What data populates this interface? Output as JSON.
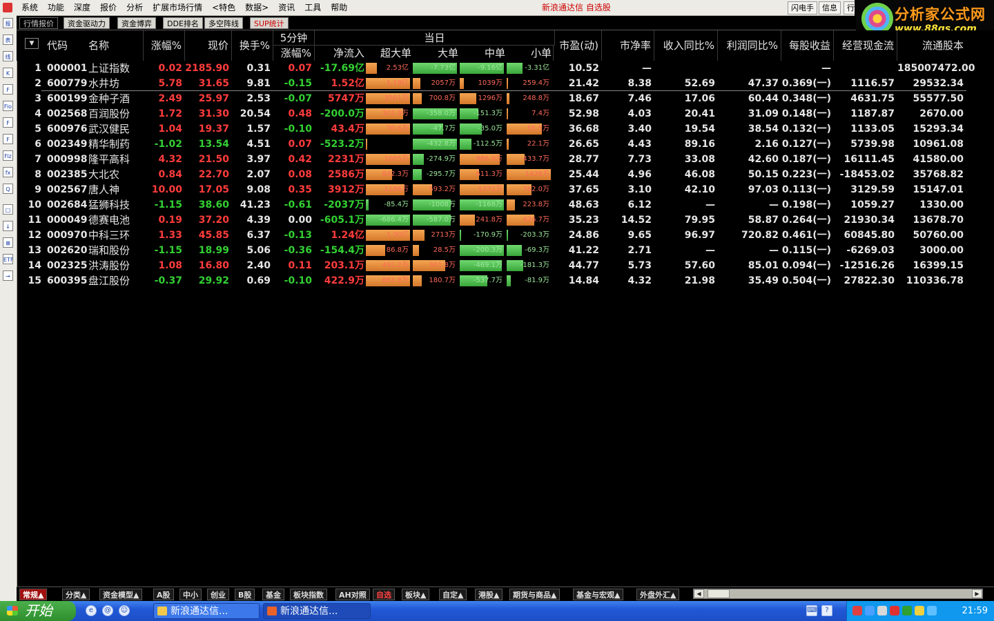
{
  "menu": [
    "系统",
    "功能",
    "深度",
    "报价",
    "分析",
    "扩展市场行情",
    "<特色",
    "数据>",
    "资讯",
    "工具",
    "帮助"
  ],
  "app_title": "新浪通达信  自选股",
  "top_buttons": [
    "闪电手",
    "信息",
    "行"
  ],
  "logo": {
    "title": "分析家公式网",
    "url": "www.88gs.com"
  },
  "left_tools": [
    "报",
    "表",
    "线",
    "K",
    "F",
    "Fio",
    "F",
    "F",
    "Fiz",
    "fx",
    "Q",
    "□",
    "↓",
    "⊠",
    "ETF",
    "→"
  ],
  "tabs": [
    "行情报价",
    "资金驱动力",
    "资金博弈",
    "DDE排名",
    "多空阵线",
    "SUP统计"
  ],
  "header": {
    "code": "代码",
    "name": "名称",
    "change": "涨幅%",
    "price": "现价",
    "turnover": "换手%",
    "five_min": "5分钟",
    "five_min_sub": "涨幅%",
    "today": "当日",
    "net_inflow": "净流入",
    "super_large": "超大单",
    "large": "大单",
    "medium": "中单",
    "small": "小单",
    "pe": "市盈(动)",
    "pb": "市净率",
    "rev_yoy": "收入同比%",
    "profit_yoy": "利润同比%",
    "eps": "每股收益",
    "ocf": "经营现金流",
    "float_shares": "流通股本"
  },
  "rows": [
    {
      "no": "1",
      "code": "000001",
      "name": "上证指数",
      "chg": "0.02",
      "price": "2185.90",
      "turn": "0.31",
      "m5": "0.07",
      "net": "-17.69亿",
      "f": [
        {
          "v": "2.53亿",
          "w": 0.25,
          "s": 1
        },
        {
          "v": "-7.73亿",
          "w": 1.0,
          "s": -1
        },
        {
          "v": "-9.16亿",
          "w": 1.0,
          "s": -1
        },
        {
          "v": "-3.31亿",
          "w": 0.36,
          "s": -1
        }
      ],
      "pe": "10.52",
      "pb": "—",
      "rev": "",
      "prof": "",
      "eps": "—",
      "ocf": "",
      "fs": "185007472.00"
    },
    {
      "no": "2",
      "code": "600779",
      "name": "水井坊",
      "chg": "5.78",
      "price": "31.65",
      "turn": "9.81",
      "m5": "-0.15",
      "net": "1.52亿",
      "f": [
        {
          "v": "1.18亿",
          "w": 1.0,
          "s": 1
        },
        {
          "v": "2057万",
          "w": 0.17,
          "s": 1
        },
        {
          "v": "1039万",
          "w": 0.09,
          "s": 1
        },
        {
          "v": "259.4万",
          "w": 0.03,
          "s": 1
        }
      ],
      "pe": "21.42",
      "pb": "8.38",
      "rev": "52.69",
      "prof": "47.37",
      "eps": "0.369(一)",
      "ocf": "1116.57",
      "fs": "29532.34"
    },
    {
      "no": "3",
      "code": "600199",
      "name": "金种子酒",
      "chg": "2.49",
      "price": "25.97",
      "turn": "2.53",
      "m5": "-0.07",
      "net": "5747万",
      "f": [
        {
          "v": "3501万",
          "w": 1.0,
          "s": 1
        },
        {
          "v": "700.8万",
          "w": 0.2,
          "s": 1
        },
        {
          "v": "1296万",
          "w": 0.37,
          "s": 1
        },
        {
          "v": "248.8万",
          "w": 0.07,
          "s": 1
        }
      ],
      "pe": "18.67",
      "pb": "7.46",
      "rev": "17.06",
      "prof": "60.44",
      "eps": "0.348(一)",
      "ocf": "4631.75",
      "fs": "55577.50"
    },
    {
      "no": "4",
      "code": "002568",
      "name": "百润股份",
      "chg": "1.72",
      "price": "31.30",
      "turn": "20.54",
      "m5": "0.48",
      "net": "-200.0万",
      "f": [
        {
          "v": "301.9万",
          "w": 0.84,
          "s": 1
        },
        {
          "v": "-358.0万",
          "w": 1.0,
          "s": -1
        },
        {
          "v": "-151.3万",
          "w": 0.42,
          "s": -1
        },
        {
          "v": "7.4万",
          "w": 0.02,
          "s": 1
        }
      ],
      "pe": "52.98",
      "pb": "4.03",
      "rev": "20.41",
      "prof": "31.09",
      "eps": "0.148(一)",
      "ocf": "1187.87",
      "fs": "2670.00"
    },
    {
      "no": "5",
      "code": "600976",
      "name": "武汉健民",
      "chg": "1.04",
      "price": "19.37",
      "turn": "1.57",
      "m5": "-0.10",
      "net": "43.4万",
      "f": [
        {
          "v": "70.6万",
          "w": 1.0,
          "s": 1
        },
        {
          "v": "-47.7万",
          "w": 0.68,
          "s": -1
        },
        {
          "v": "-35.0万",
          "w": 0.5,
          "s": -1
        },
        {
          "v": "55.5万",
          "w": 0.79,
          "s": 1
        }
      ],
      "pe": "36.68",
      "pb": "3.40",
      "rev": "19.54",
      "prof": "38.54",
      "eps": "0.132(一)",
      "ocf": "1133.05",
      "fs": "15293.34"
    },
    {
      "no": "6",
      "code": "002349",
      "name": "精华制药",
      "chg": "-1.02",
      "price": "13.54",
      "turn": "4.51",
      "m5": "0.07",
      "net": "-523.2万",
      "f": [
        {
          "v": "",
          "w": 0.03,
          "s": 1
        },
        {
          "v": "-432.8万",
          "w": 1.0,
          "s": -1
        },
        {
          "v": "-112.5万",
          "w": 0.26,
          "s": -1
        },
        {
          "v": "22.1万",
          "w": 0.05,
          "s": 1
        }
      ],
      "pe": "26.65",
      "pb": "4.43",
      "rev": "89.16",
      "prof": "2.16",
      "eps": "0.127(一)",
      "ocf": "5739.98",
      "fs": "10961.08"
    },
    {
      "no": "7",
      "code": "000998",
      "name": "隆平高科",
      "chg": "4.32",
      "price": "21.50",
      "turn": "3.97",
      "m5": "0.42",
      "net": "2231万",
      "f": [
        {
          "v": "1085万",
          "w": 1.0,
          "s": 1
        },
        {
          "v": "-274.9万",
          "w": 0.25,
          "s": -1
        },
        {
          "v": "986.9万",
          "w": 0.91,
          "s": 1
        },
        {
          "v": "433.7万",
          "w": 0.4,
          "s": 1
        }
      ],
      "pe": "28.77",
      "pb": "7.73",
      "rev": "33.08",
      "prof": "42.60",
      "eps": "0.187(一)",
      "ocf": "16111.45",
      "fs": "41580.00"
    },
    {
      "no": "8",
      "code": "002385",
      "name": "大北农",
      "chg": "0.84",
      "price": "22.70",
      "turn": "2.07",
      "m5": "0.08",
      "net": "2586万",
      "f": [
        {
          "v": "842.3万",
          "w": 0.59,
          "s": 1
        },
        {
          "v": "-295.7万",
          "w": 0.21,
          "s": -1
        },
        {
          "v": "611.3万",
          "w": 0.43,
          "s": 1
        },
        {
          "v": "1428万",
          "w": 1.0,
          "s": 1
        }
      ],
      "pe": "25.44",
      "pb": "4.96",
      "rev": "46.08",
      "prof": "50.15",
      "eps": "0.223(一)",
      "ocf": "-18453.02",
      "fs": "35768.82"
    },
    {
      "no": "9",
      "code": "002567",
      "name": "唐人神",
      "chg": "10.00",
      "price": "17.05",
      "turn": "9.08",
      "m5": "0.35",
      "net": "3912万",
      "f": [
        {
          "v": "1186万",
          "w": 0.87,
          "s": 1
        },
        {
          "v": "593.2万",
          "w": 0.43,
          "s": 1
        },
        {
          "v": "1371万",
          "w": 1.0,
          "s": 1
        },
        {
          "v": "762.0万",
          "w": 0.56,
          "s": 1
        }
      ],
      "pe": "37.65",
      "pb": "3.10",
      "rev": "42.10",
      "prof": "97.03",
      "eps": "0.113(一)",
      "ocf": "3129.59",
      "fs": "15147.01"
    },
    {
      "no": "10",
      "code": "002684",
      "name": "猛狮科技",
      "chg": "-1.15",
      "price": "38.60",
      "turn": "41.23",
      "m5": "-0.61",
      "net": "-2037万",
      "f": [
        {
          "v": "-85.4万",
          "w": 0.07,
          "s": -1
        },
        {
          "v": "-1008万",
          "w": 0.86,
          "s": -1
        },
        {
          "v": "-1168万",
          "w": 1.0,
          "s": -1
        },
        {
          "v": "223.8万",
          "w": 0.19,
          "s": 1
        }
      ],
      "pe": "48.63",
      "pb": "6.12",
      "rev": "—",
      "prof": "—",
      "eps": "0.198(一)",
      "ocf": "1059.27",
      "fs": "1330.00"
    },
    {
      "no": "11",
      "code": "000049",
      "name": "德赛电池",
      "chg": "0.19",
      "price": "37.20",
      "turn": "4.39",
      "m5": "0.00",
      "net": "-605.1万",
      "f": [
        {
          "v": "-686.4万",
          "w": 1.0,
          "s": -1
        },
        {
          "v": "-587.0万",
          "w": 0.86,
          "s": -1
        },
        {
          "v": "241.8万",
          "w": 0.35,
          "s": 1
        },
        {
          "v": "426.7万",
          "w": 0.62,
          "s": 1
        }
      ],
      "pe": "35.23",
      "pb": "14.52",
      "rev": "79.95",
      "prof": "58.87",
      "eps": "0.264(一)",
      "ocf": "21930.34",
      "fs": "13678.70"
    },
    {
      "no": "12",
      "code": "000970",
      "name": "中科三环",
      "chg": "1.33",
      "price": "45.85",
      "turn": "6.37",
      "m5": "-0.13",
      "net": "1.24亿",
      "f": [
        {
          "v": "1.00亿",
          "w": 1.0,
          "s": 1
        },
        {
          "v": "2713万",
          "w": 0.27,
          "s": 1
        },
        {
          "v": "-170.9万",
          "w": 0.02,
          "s": -1
        },
        {
          "v": "-203.3万",
          "w": 0.02,
          "s": -1
        }
      ],
      "pe": "24.86",
      "pb": "9.65",
      "rev": "96.97",
      "prof": "720.82",
      "eps": "0.461(一)",
      "ocf": "60845.80",
      "fs": "50760.00"
    },
    {
      "no": "13",
      "code": "002620",
      "name": "瑞和股份",
      "chg": "-1.15",
      "price": "18.99",
      "turn": "5.06",
      "m5": "-0.36",
      "net": "-154.4万",
      "f": [
        {
          "v": "86.8万",
          "w": 0.43,
          "s": 1
        },
        {
          "v": "28.5万",
          "w": 0.14,
          "s": 1
        },
        {
          "v": "-200.3万",
          "w": 1.0,
          "s": -1
        },
        {
          "v": "-69.3万",
          "w": 0.35,
          "s": -1
        }
      ],
      "pe": "41.22",
      "pb": "2.71",
      "rev": "—",
      "prof": "—",
      "eps": "0.115(一)",
      "ocf": "-6269.03",
      "fs": "3000.00"
    },
    {
      "no": "14",
      "code": "002325",
      "name": "洪涛股份",
      "chg": "1.08",
      "price": "16.80",
      "turn": "2.40",
      "m5": "0.11",
      "net": "203.1万",
      "f": [
        {
          "v": "492.2万",
          "w": 1.0,
          "s": 1
        },
        {
          "v": "361.8万",
          "w": 0.74,
          "s": 1
        },
        {
          "v": "-469.1万",
          "w": 0.95,
          "s": -1
        },
        {
          "v": "-181.3万",
          "w": 0.37,
          "s": -1
        }
      ],
      "pe": "44.77",
      "pb": "5.73",
      "rev": "57.60",
      "prof": "85.01",
      "eps": "0.094(一)",
      "ocf": "-12516.26",
      "fs": "16399.15"
    },
    {
      "no": "15",
      "code": "600395",
      "name": "盘江股份",
      "chg": "-0.37",
      "price": "29.92",
      "turn": "0.69",
      "m5": "-0.10",
      "net": "422.9万",
      "f": [
        {
          "v": "861.8万",
          "w": 1.0,
          "s": 1
        },
        {
          "v": "180.7万",
          "w": 0.21,
          "s": 1
        },
        {
          "v": "-537.7万",
          "w": 0.62,
          "s": -1
        },
        {
          "v": "-81.9万",
          "w": 0.1,
          "s": -1
        }
      ],
      "pe": "14.84",
      "pb": "4.32",
      "rev": "21.98",
      "prof": "35.49",
      "eps": "0.504(一)",
      "ocf": "27822.30",
      "fs": "110336.78"
    }
  ],
  "bottom_tabs": [
    "常规▲",
    "分类▲",
    "资金模型▲",
    "A股",
    "中小",
    "创业",
    "B股",
    "基金",
    "板块指数",
    "AH对照",
    "自选",
    "板块▲",
    "自定▲",
    "港股▲",
    "期货与商品▲",
    "基金与宏观▲",
    "外盘外汇▲"
  ],
  "taskbar": {
    "start": "开始",
    "tasks": [
      "新浪通达信...",
      "新浪通达信..."
    ],
    "clock": "21:59"
  },
  "colors": {
    "up": "#ff3c3c",
    "down": "#33d033",
    "inflow_bar": "#e88a3a",
    "outflow_bar": "#4cc04c"
  }
}
